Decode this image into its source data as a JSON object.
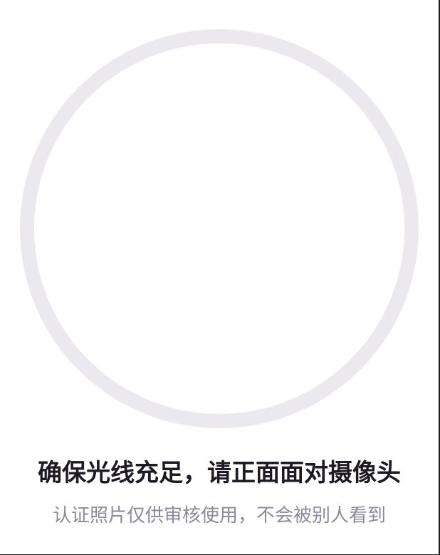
{
  "camera": {
    "ring_color": "#ebe9ed"
  },
  "instruction": {
    "title": "确保光线充足，请正面面对摄像头",
    "subtitle": "认证照片仅供审核使用，不会被别人看到"
  },
  "colors": {
    "title_text": "#1d1a24",
    "subtitle_text": "#8d889b",
    "background": "#ffffff"
  }
}
